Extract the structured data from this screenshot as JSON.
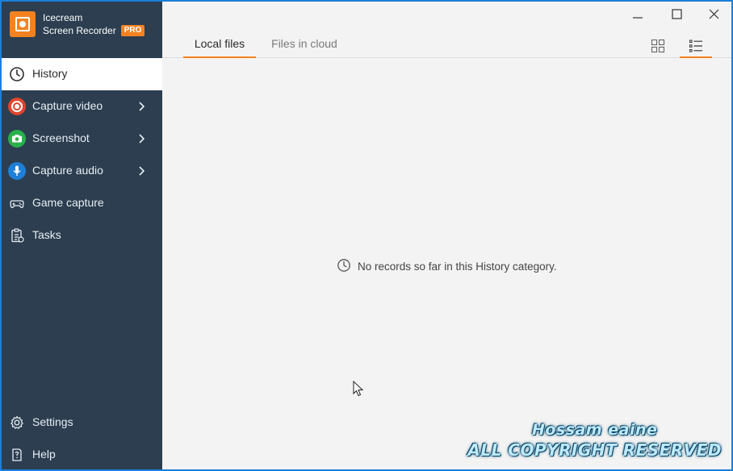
{
  "app": {
    "name_line1": "Icecream",
    "name_line2": "Screen Recorder",
    "badge": "PRO",
    "accent_color": "#f58220",
    "sidebar_color": "#2c3e50"
  },
  "sidebar": {
    "items": [
      {
        "label": "History",
        "icon": "clock-icon",
        "active": true
      },
      {
        "label": "Capture video",
        "icon": "record-icon",
        "has_submenu": true,
        "icon_color": "#e0452c"
      },
      {
        "label": "Screenshot",
        "icon": "camera-icon",
        "has_submenu": true,
        "icon_color": "#27b24a"
      },
      {
        "label": "Capture audio",
        "icon": "microphone-icon",
        "has_submenu": true,
        "icon_color": "#1d7fd8"
      },
      {
        "label": "Game capture",
        "icon": "gamepad-icon"
      },
      {
        "label": "Tasks",
        "icon": "tasks-icon"
      }
    ],
    "bottom_items": [
      {
        "label": "Settings",
        "icon": "gear-icon"
      },
      {
        "label": "Help",
        "icon": "help-icon"
      }
    ]
  },
  "window_controls": {
    "minimize": "minimize-icon",
    "maximize": "maximize-icon",
    "close": "close-icon"
  },
  "tabs": [
    {
      "label": "Local files",
      "active": true
    },
    {
      "label": "Files in cloud",
      "active": false
    }
  ],
  "view_modes": {
    "grid": "grid-view-icon",
    "list": "list-view-icon",
    "active": "list"
  },
  "empty_state": {
    "icon": "clock-icon",
    "message": "No records so far in this History category."
  },
  "watermark": {
    "line1": "Hossam eaine",
    "line2": "ALL COPYRIGHT RESERVED"
  }
}
